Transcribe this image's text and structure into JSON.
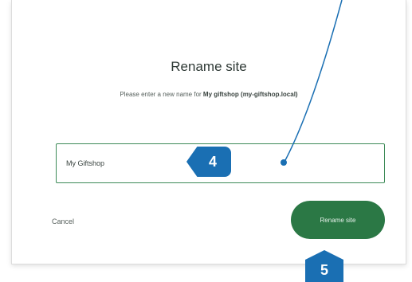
{
  "dialog": {
    "title": "Rename site",
    "subtitle_prefix": "Please enter a new name for",
    "subtitle_site": "My giftshop (my-giftshop.local)",
    "input_value": "My Giftshop",
    "cancel_label": "Cancel",
    "confirm_label": "Rename site"
  },
  "callouts": {
    "step_4": "4",
    "step_5": "5"
  },
  "colors": {
    "accent_green": "#2b7845",
    "input_border": "#3c8a57",
    "callout_blue": "#1a6fb3"
  }
}
